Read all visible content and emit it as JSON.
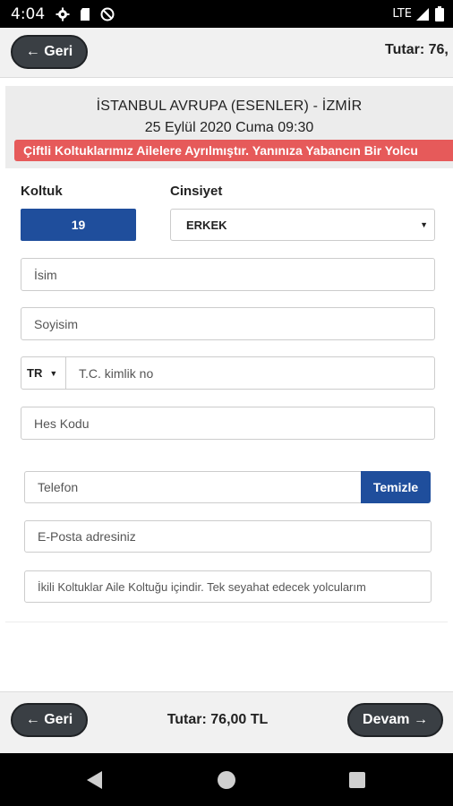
{
  "status_bar": {
    "time": "4:04",
    "network": "LTE",
    "icons": [
      "gear-icon",
      "sd-card-icon",
      "no-data-icon",
      "signal-icon",
      "battery-icon"
    ]
  },
  "top_bar": {
    "back_label": "← Geri",
    "total_label": "Tutar: 76,"
  },
  "trip": {
    "route": "İSTANBUL AVRUPA (ESENLER) - İZMİR",
    "date": "25 Eylül 2020 Cuma 09:30",
    "warning": "Çiftli Koltuklarımız Ailelere Ayrılmıştır. Yanınıza Yabancın Bir Yolcu"
  },
  "form": {
    "seat_label": "Koltuk",
    "seat_value": "19",
    "gender_label": "Cinsiyet",
    "gender_value": "ERKEK",
    "name_placeholder": "İsim",
    "surname_placeholder": "Soyisim",
    "country_code": "TR",
    "tc_placeholder": "T.C. kimlik no",
    "hes_placeholder": "Hes Kodu",
    "phone_placeholder": "Telefon",
    "clear_label": "Temizle",
    "email_placeholder": "E-Posta adresiniz",
    "note_placeholder": "İkili Koltuklar Aile Koltuğu içindir. Tek seyahat edecek yolcularım"
  },
  "bottom_bar": {
    "back_label": "← Geri",
    "total_label": "Tutar: 76,00 TL",
    "next_label": "Devam →"
  },
  "colors": {
    "primary_blue": "#1f4e9c",
    "warning_red": "#e65a5a",
    "pill_dark": "#3a3f44"
  }
}
